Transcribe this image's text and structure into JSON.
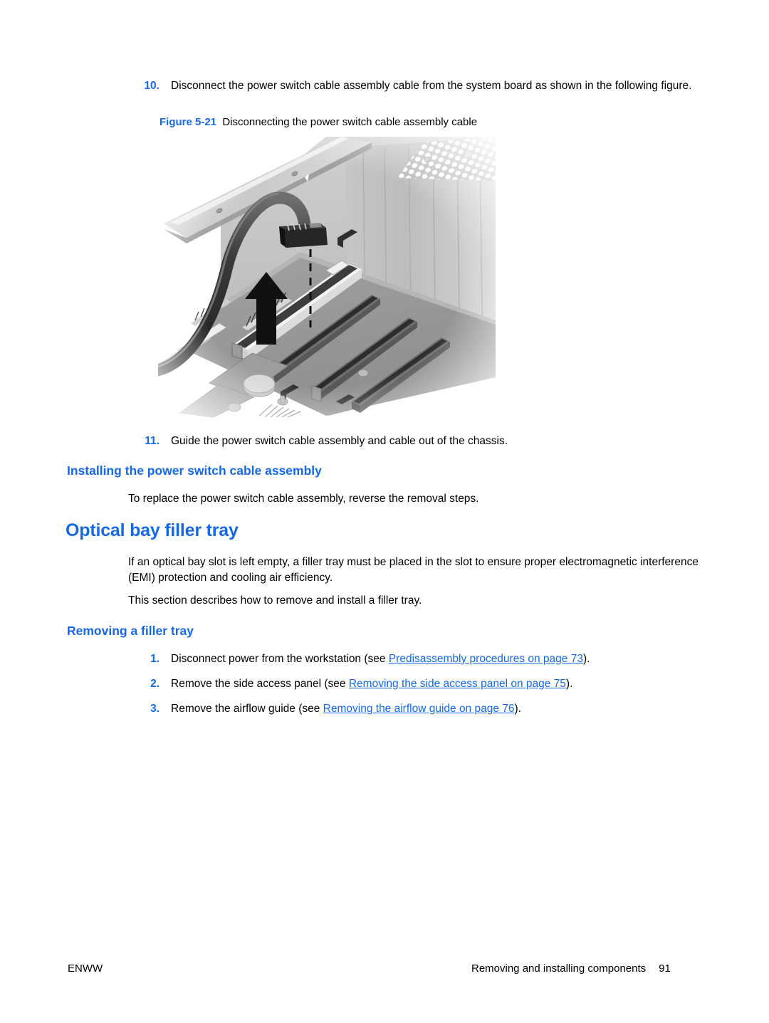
{
  "document": {
    "steps_top": [
      {
        "number": "10.",
        "text": "Disconnect the power switch cable assembly cable from the system board as shown in the following figure."
      },
      {
        "number": "11.",
        "text": "Guide the power switch cable assembly and cable out of the chassis."
      }
    ],
    "figure": {
      "label": "Figure 5-21",
      "caption": "Disconnecting the power switch cable assembly cable",
      "alt": "Grayscale photo of a workstation chassis interior showing the power switch cable assembly connector being lifted off its system board header, with an upward arrow and dashed guide line"
    },
    "heading_installing": "Installing the power switch cable assembly",
    "para_installing": "To replace the power switch cable assembly, reverse the removal steps.",
    "heading_optical_bay": "Optical bay filler tray",
    "para_optical_1": "If an optical bay slot is left empty, a filler tray must be placed in the slot to ensure proper electromagnetic interference (EMI) protection and cooling air efficiency.",
    "para_optical_2": "This section describes how to remove and install a filler tray.",
    "heading_removing": "Removing a filler tray",
    "removal_steps": [
      {
        "number": "1.",
        "prefix": "Disconnect power from the workstation (see ",
        "link": "Predisassembly procedures on page 73",
        "suffix": ")."
      },
      {
        "number": "2.",
        "prefix": "Remove the side access panel (see ",
        "link": "Removing the side access panel on page 75",
        "suffix": ")."
      },
      {
        "number": "3.",
        "prefix": "Remove the airflow guide (see ",
        "link": "Removing the airflow guide on page 76",
        "suffix": ")."
      }
    ],
    "footer": {
      "left": "ENWW",
      "right_title": "Removing and installing components",
      "page_number": "91"
    },
    "colors": {
      "accent_blue": "#1569e8",
      "body_black": "#000000",
      "page_background": "#ffffff"
    }
  }
}
